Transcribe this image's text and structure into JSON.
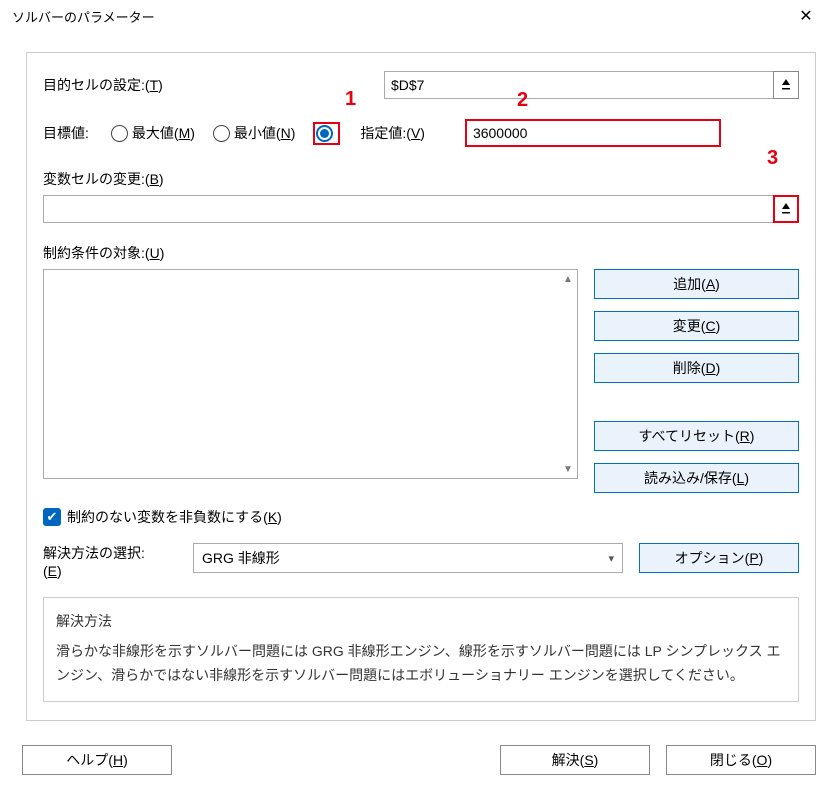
{
  "window": {
    "title": "ソルバーのパラメーター"
  },
  "labels": {
    "objective": "目的セルの設定:(",
    "objective_key": "T",
    "objective_close": ")",
    "target": "目標値:",
    "max": "最大値(",
    "max_key": "M",
    "max_close": ")",
    "min": "最小値(",
    "min_key": "N",
    "min_close": ")",
    "valueof": "指定値:(",
    "valueof_key": "V",
    "valueof_close": ")",
    "changing": "変数セルの変更:(",
    "changing_key": "B",
    "changing_close": ")",
    "constraints": "制約条件の対象:(",
    "constraints_key": "U",
    "constraints_close": ")",
    "nonneg_pre": "制約のない変数を非負数にする(",
    "nonneg_key": "K",
    "nonneg_close": ")",
    "method_label1": "解決方法の選択:",
    "method_key_open": "(",
    "method_key": "E",
    "method_key_close": ")",
    "desc_title": "解決方法",
    "desc_body": "滑らかな非線形を示すソルバー問題には GRG 非線形エンジン、線形を示すソルバー問題には LP シンプレックス エンジン、滑らかではない非線形を示すソルバー問題にはエボリューショナリー エンジンを選択してください。"
  },
  "values": {
    "objective_cell": "$D$7",
    "valueof": "3600000",
    "changing_cells": "",
    "method_selected": "GRG 非線形"
  },
  "buttons": {
    "add": "追加(",
    "add_key": "A",
    "change": "変更(",
    "change_key": "C",
    "delete": "削除(",
    "delete_key": "D",
    "reset": "すべてリセット(",
    "reset_key": "R",
    "loadsave": "読み込み/保存(",
    "loadsave_key": "L",
    "options": "オプション(",
    "options_key": "P",
    "help": "ヘルプ(",
    "help_key": "H",
    "solve": "解決(",
    "solve_key": "S",
    "close_btn": "閉じる(",
    "close_key": "O",
    "paren_close": ")"
  },
  "callouts": {
    "one": "1",
    "two": "2",
    "three": "3"
  }
}
